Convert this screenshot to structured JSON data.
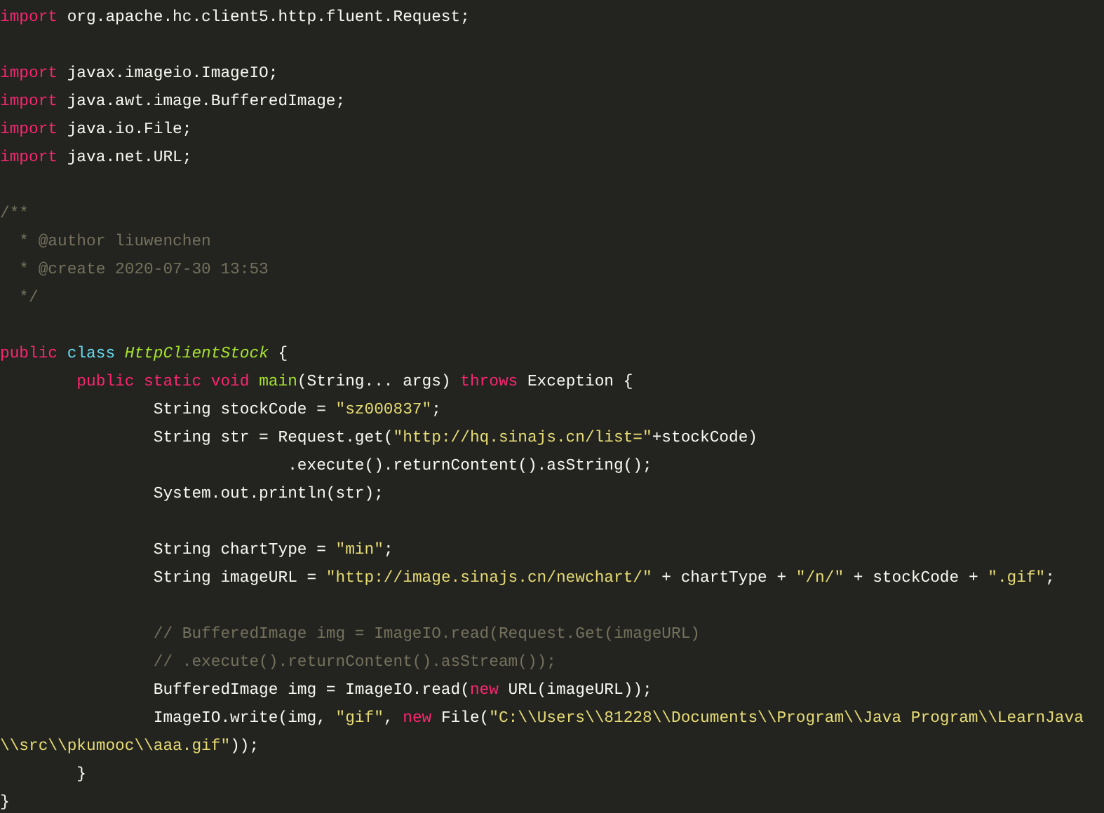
{
  "editor": {
    "lines": [
      {
        "kind": "code",
        "tokens": [
          {
            "kind": "keyword",
            "text": "import"
          },
          {
            "kind": "plain",
            "text": " org.apache.hc.client5.http.fluent.Request;"
          }
        ]
      },
      {
        "kind": "blank"
      },
      {
        "kind": "code",
        "tokens": [
          {
            "kind": "keyword",
            "text": "import"
          },
          {
            "kind": "plain",
            "text": " javax.imageio.ImageIO;"
          }
        ]
      },
      {
        "kind": "code",
        "tokens": [
          {
            "kind": "keyword",
            "text": "import"
          },
          {
            "kind": "plain",
            "text": " java.awt.image.BufferedImage;"
          }
        ]
      },
      {
        "kind": "code",
        "tokens": [
          {
            "kind": "keyword",
            "text": "import"
          },
          {
            "kind": "plain",
            "text": " java.io.File;"
          }
        ]
      },
      {
        "kind": "code",
        "tokens": [
          {
            "kind": "keyword",
            "text": "import"
          },
          {
            "kind": "plain",
            "text": " java.net.URL;"
          }
        ]
      },
      {
        "kind": "blank"
      },
      {
        "kind": "code",
        "tokens": [
          {
            "kind": "comment",
            "text": "/**"
          }
        ]
      },
      {
        "kind": "code",
        "tokens": [
          {
            "kind": "comment",
            "text": "  * @author liuwenchen"
          }
        ]
      },
      {
        "kind": "code",
        "tokens": [
          {
            "kind": "comment",
            "text": "  * @create 2020-07-30 13:53"
          }
        ]
      },
      {
        "kind": "code",
        "tokens": [
          {
            "kind": "comment",
            "text": "  */"
          }
        ]
      },
      {
        "kind": "blank"
      },
      {
        "kind": "code",
        "tokens": [
          {
            "kind": "keyword",
            "text": "public "
          },
          {
            "kind": "storage",
            "text": "class "
          },
          {
            "kind": "classname",
            "text": "HttpClientStock"
          },
          {
            "kind": "plain",
            "text": " {"
          }
        ]
      },
      {
        "kind": "code",
        "tokens": [
          {
            "kind": "keyword",
            "text": "        public static void "
          },
          {
            "kind": "function",
            "text": "main"
          },
          {
            "kind": "plain",
            "text": "(String... args) "
          },
          {
            "kind": "keyword",
            "text": "throws"
          },
          {
            "kind": "plain",
            "text": " Exception {"
          }
        ]
      },
      {
        "kind": "code",
        "tokens": [
          {
            "kind": "plain",
            "text": "                String stockCode = "
          },
          {
            "kind": "string",
            "text": "\"sz000837\""
          },
          {
            "kind": "plain",
            "text": ";"
          }
        ]
      },
      {
        "kind": "code",
        "tokens": [
          {
            "kind": "plain",
            "text": "                String str = Request.get("
          },
          {
            "kind": "string",
            "text": "\"http://hq.sinajs.cn/list=\""
          },
          {
            "kind": "plain",
            "text": "+stockCode)"
          }
        ]
      },
      {
        "kind": "code",
        "tokens": [
          {
            "kind": "plain",
            "text": "                              .execute().returnContent().asString();"
          }
        ]
      },
      {
        "kind": "code",
        "tokens": [
          {
            "kind": "plain",
            "text": "                System.out.println(str);"
          }
        ]
      },
      {
        "kind": "blank"
      },
      {
        "kind": "code",
        "tokens": [
          {
            "kind": "plain",
            "text": "                String chartType = "
          },
          {
            "kind": "string",
            "text": "\"min\""
          },
          {
            "kind": "plain",
            "text": ";"
          }
        ]
      },
      {
        "kind": "code",
        "tokens": [
          {
            "kind": "plain",
            "text": "                String imageURL = "
          },
          {
            "kind": "string",
            "text": "\"http://image.sinajs.cn/newchart/\""
          },
          {
            "kind": "plain",
            "text": " + chartType + "
          },
          {
            "kind": "string",
            "text": "\"/n/\""
          },
          {
            "kind": "plain",
            "text": " + stockCode + "
          },
          {
            "kind": "string",
            "text": "\".gif\""
          },
          {
            "kind": "plain",
            "text": ";"
          }
        ]
      },
      {
        "kind": "blank"
      },
      {
        "kind": "code",
        "tokens": [
          {
            "kind": "comment",
            "text": "                // BufferedImage img = ImageIO.read(Request.Get(imageURL)"
          }
        ]
      },
      {
        "kind": "code",
        "tokens": [
          {
            "kind": "comment",
            "text": "                // .execute().returnContent().asStream());"
          }
        ]
      },
      {
        "kind": "code",
        "tokens": [
          {
            "kind": "plain",
            "text": "                BufferedImage img = ImageIO.read("
          },
          {
            "kind": "keyword",
            "text": "new"
          },
          {
            "kind": "plain",
            "text": " URL(imageURL));"
          }
        ]
      },
      {
        "kind": "code",
        "tokens": [
          {
            "kind": "plain",
            "text": "                ImageIO.write(img, "
          },
          {
            "kind": "string",
            "text": "\"gif\""
          },
          {
            "kind": "plain",
            "text": ", "
          },
          {
            "kind": "keyword",
            "text": "new"
          },
          {
            "kind": "plain",
            "text": " File("
          },
          {
            "kind": "string",
            "text": "\"C:\\\\Users\\\\81228\\\\Documents\\\\Program\\\\Java Program\\\\LearnJava"
          }
        ]
      },
      {
        "kind": "code",
        "tokens": [
          {
            "kind": "string",
            "text": "\\\\src\\\\pkumooc\\\\aaa.gif\""
          },
          {
            "kind": "plain",
            "text": "));"
          }
        ]
      },
      {
        "kind": "code",
        "tokens": [
          {
            "kind": "plain",
            "text": "        }"
          }
        ]
      },
      {
        "kind": "code",
        "tokens": [
          {
            "kind": "plain",
            "text": "}"
          }
        ]
      }
    ]
  }
}
